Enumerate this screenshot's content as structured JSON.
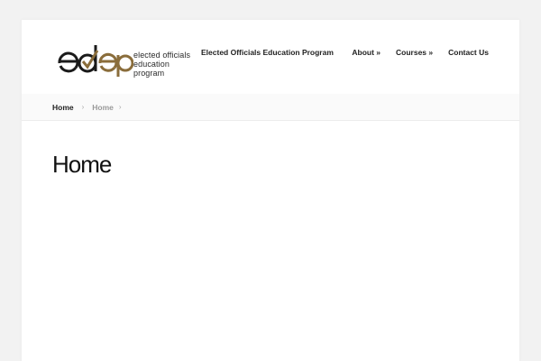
{
  "logo": {
    "tagline_line1": "elected officials",
    "tagline_line2": "education program",
    "colors": {
      "dark": "#1a1a1a",
      "gold": "#8a6d3b"
    }
  },
  "header": {
    "site_title": "Elected Officials Education Program",
    "nav": [
      {
        "label": "About »"
      },
      {
        "label": "Courses »"
      },
      {
        "label": "Contact Us"
      }
    ]
  },
  "breadcrumb": {
    "home": "Home",
    "current": "Home",
    "separator_icon": "chevron-right-icon"
  },
  "main": {
    "title": "Home"
  }
}
